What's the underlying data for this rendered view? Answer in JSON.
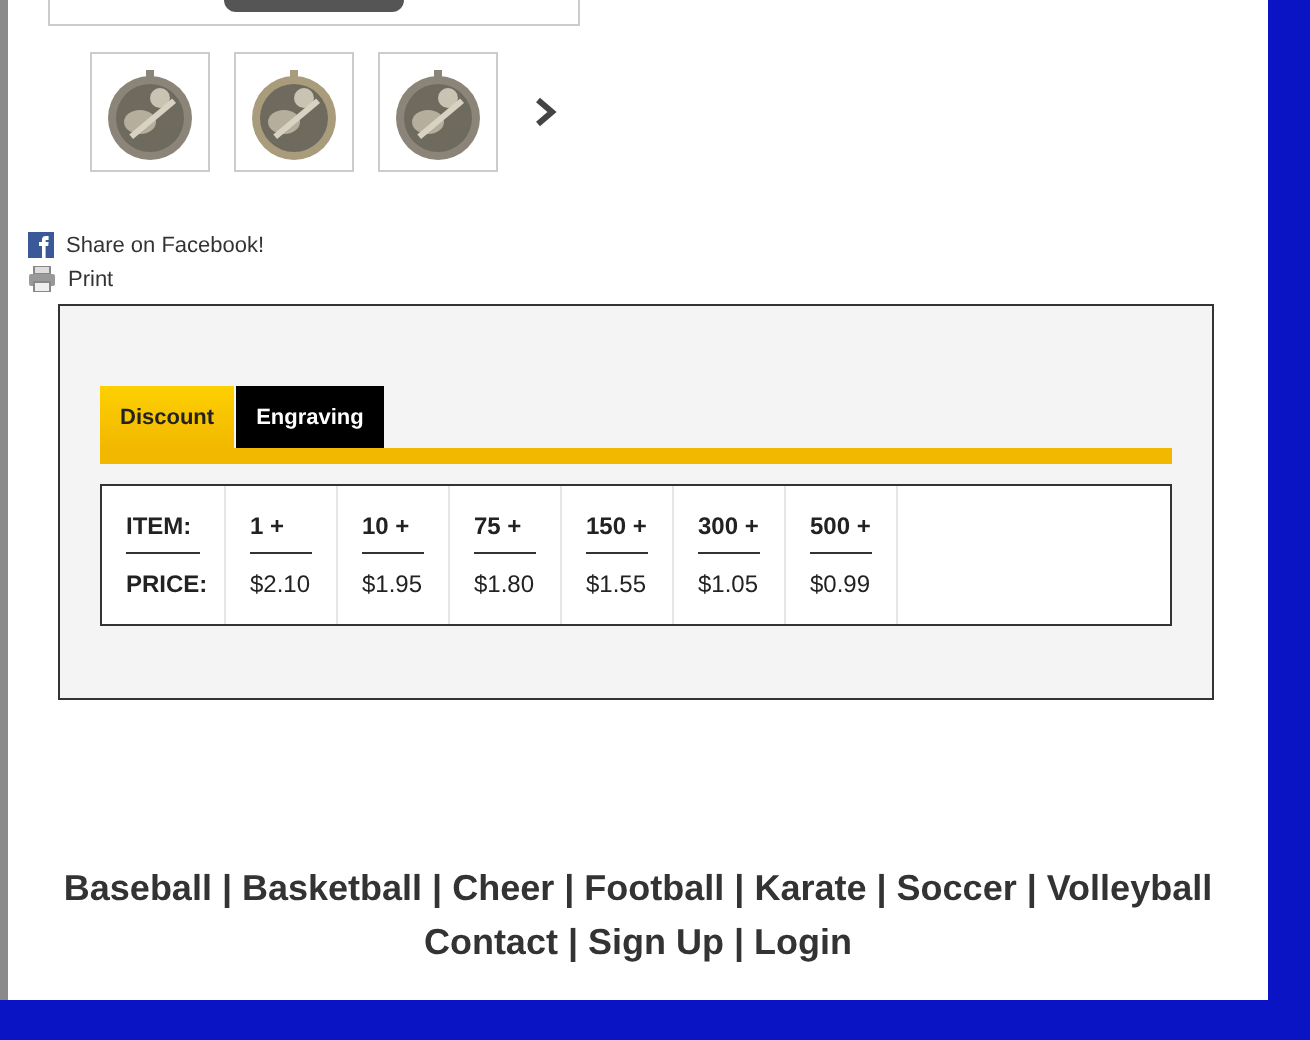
{
  "share": {
    "facebook": "Share on Facebook!",
    "print": "Print"
  },
  "tabs": [
    {
      "label": "Discount",
      "selected": true
    },
    {
      "label": "Engraving",
      "selected": false
    }
  ],
  "pricing": {
    "item_label": "ITEM:",
    "price_label": "PRICE:",
    "tiers": [
      {
        "quantity": "1 +",
        "price": "$2.10"
      },
      {
        "quantity": "10 +",
        "price": "$1.95"
      },
      {
        "quantity": "75 +",
        "price": "$1.80"
      },
      {
        "quantity": "150 +",
        "price": "$1.55"
      },
      {
        "quantity": "300 +",
        "price": "$1.05"
      },
      {
        "quantity": "500 +",
        "price": "$0.99"
      }
    ]
  },
  "footer": {
    "separator": "|",
    "lines": [
      [
        "Baseball",
        "Basketball",
        "Cheer",
        "Football",
        "Karate",
        "Soccer",
        "Volleyball"
      ],
      [
        "Contact",
        "Sign Up",
        "Login"
      ]
    ]
  }
}
